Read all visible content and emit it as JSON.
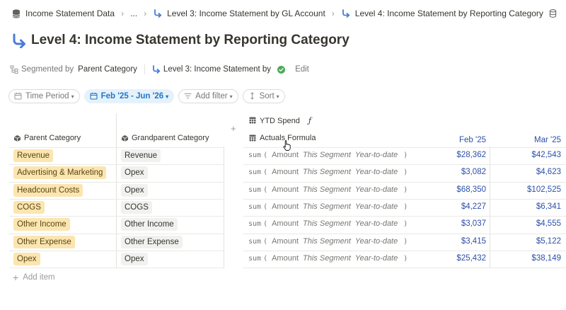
{
  "breadcrumb": {
    "items": [
      "Income Statement Data",
      "...",
      "Level 3: Income Statement by GL Account",
      "Level 4: Income Statement by Reporting Category"
    ]
  },
  "page": {
    "title": "Level 4: Income Statement by Reporting Category"
  },
  "meta": {
    "segmented_by_label": "Segmented by",
    "segmented_by_value": "Parent Category",
    "source_label": "Level 3: Income Statement by",
    "edit_label": "Edit"
  },
  "filters": {
    "time_period": "Time Period",
    "date_range": "Feb '25 - Jun '26",
    "add_filter": "Add filter",
    "sort": "Sort"
  },
  "table": {
    "col_parent": "Parent Category",
    "col_grandparent": "Grandparent Category",
    "metric_title": "YTD Spend",
    "metric_formula_label": "Actuals Formula",
    "add_column": "+",
    "months": [
      "Feb '25",
      "Mar '25"
    ],
    "formula": {
      "fn": "sum",
      "open": "(",
      "arg1": "Amount",
      "arg2": "This Segment",
      "arg3": "Year-to-date",
      "close": ")"
    },
    "rows": [
      {
        "parent": "Revenue",
        "grandparent": "Revenue",
        "feb": "$28,362",
        "mar": "$42,543"
      },
      {
        "parent": "Advertising & Marketing",
        "grandparent": "Opex",
        "feb": "$3,082",
        "mar": "$4,623"
      },
      {
        "parent": "Headcount Costs",
        "grandparent": "Opex",
        "feb": "$68,350",
        "mar": "$102,525"
      },
      {
        "parent": "COGS",
        "grandparent": "COGS",
        "feb": "$4,227",
        "mar": "$6,341"
      },
      {
        "parent": "Other Income",
        "grandparent": "Other Income",
        "feb": "$3,037",
        "mar": "$4,555"
      },
      {
        "parent": "Other Expense",
        "grandparent": "Other Expense",
        "feb": "$3,415",
        "mar": "$5,122"
      },
      {
        "parent": "Opex",
        "grandparent": "Opex",
        "feb": "$25,432",
        "mar": "$38,149"
      }
    ],
    "add_item": "Add item"
  },
  "colors": {
    "accent": "#1f77c9",
    "value_blue": "#2c4fa8",
    "tag_yellow": "#fbe5b0",
    "tag_gray": "#f1f1ef",
    "check_green": "#4dab5a"
  }
}
